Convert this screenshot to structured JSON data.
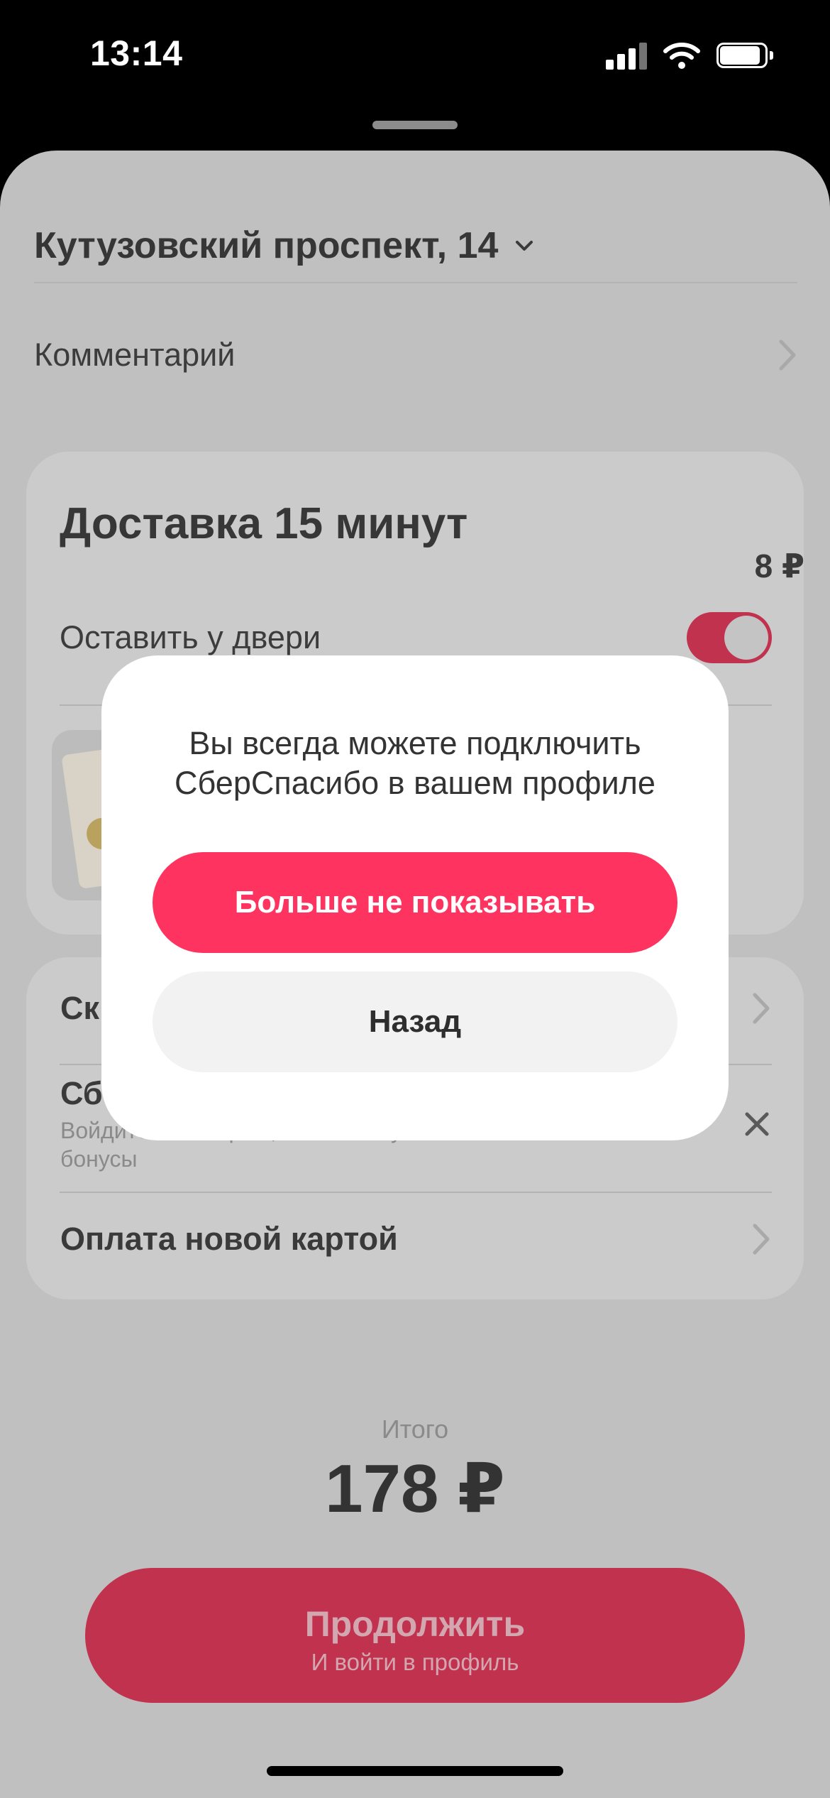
{
  "status_bar": {
    "time": "13:14"
  },
  "sheet": {
    "address": "Кутузовский проспект, 14",
    "comment_label": "Комментарий"
  },
  "delivery_card": {
    "title": "Доставка 15 минут",
    "leave_at_door_label": "Оставить у двери",
    "leave_at_door_enabled": true,
    "product_price_partial": "8 ₽"
  },
  "payment_card": {
    "row1_label_partial": "Ск",
    "row2_label_partial": "Сбе",
    "row2_subtitle": "Войдите по Сбер ID, чтобы получать и списывать бонусы",
    "new_card_label": "Оплата новой картой"
  },
  "total": {
    "label": "Итого",
    "value": "178 ₽"
  },
  "continue_button": {
    "title": "Продолжить",
    "subtitle": "И войти в профиль"
  },
  "modal": {
    "message": "Вы всегда можете подключить СберСпасибо в вашем профиле",
    "primary_button": "Больше не показывать",
    "secondary_button": "Назад"
  },
  "colors": {
    "accent": "#ff335f",
    "accent_dimmed": "#c1324f",
    "overlay_background": "#c0c0c0"
  }
}
